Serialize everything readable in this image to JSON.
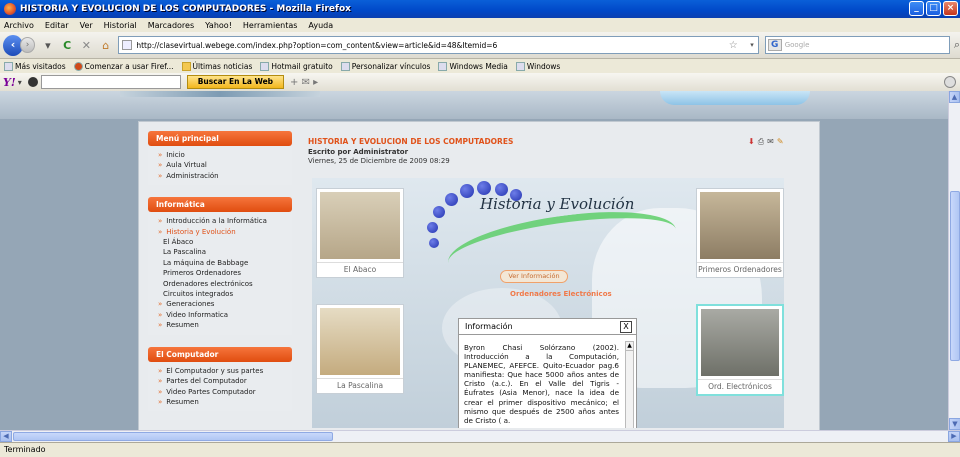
{
  "window": {
    "title": "HISTORIA Y EVOLUCION DE LOS COMPUTADORES - Mozilla Firefox"
  },
  "menubar": {
    "items": [
      "Archivo",
      "Editar",
      "Ver",
      "Historial",
      "Marcadores",
      "Yahoo!",
      "Herramientas",
      "Ayuda"
    ]
  },
  "navbar": {
    "url": "http://clasevirtual.webege.com/index.php?option=com_content&view=article&id=48&Itemid=6",
    "search_placeholder": "Google"
  },
  "bookmarks": {
    "items": [
      "Más visitados",
      "Comenzar a usar Firef...",
      "Últimas noticias",
      "Hotmail gratuito",
      "Personalizar vínculos",
      "Windows Media",
      "Windows"
    ]
  },
  "yahoo": {
    "logo": "Y!",
    "search_button": "Buscar En La Web"
  },
  "sidebar": {
    "menu_principal": {
      "title": "Menú principal",
      "items": [
        "Inicio",
        "Aula Virtual",
        "Administración"
      ]
    },
    "informatica": {
      "title": "Informática",
      "items": [
        "Introducción a la Informática",
        "Historia y Evolución"
      ],
      "subitems": [
        "El Ábaco",
        "La Pascalina",
        "La máquina de Babbage",
        "Primeros Ordenadores",
        "Ordenadores electrónicos",
        "Circuitos integrados"
      ],
      "more": [
        "Generaciones",
        "Video Informatica",
        "Resumen"
      ]
    },
    "computador": {
      "title": "El Computador",
      "items": [
        "El Computador y sus partes",
        "Partes del Computador",
        "Video Partes Computador",
        "Resumen"
      ]
    }
  },
  "article": {
    "title": "HISTORIA Y EVOLUCION DE LOS COMPUTADORES",
    "author": "Escrito por Administrator",
    "date": "Viernes, 25 de Diciembre de 2009 08:29"
  },
  "gallery": {
    "heading": "Historia y Evolución",
    "ver_info": "Ver Información",
    "current_label": "Ordenadores Electrónicos",
    "thumbs": [
      "El Abaco",
      "Primeros Ordenadores",
      "La Pascalina",
      "Ord. Electrónicos"
    ]
  },
  "infobox": {
    "title": "Información",
    "close": "X",
    "text": "Byron Chasi Solórzano (2002). Introducción a la Computación, PLANEMEC, AFEFCE. Quito-Ecuador pag.6 manifiesta: Que hace 5000 años antes de Cristo (a.c.). En el Valle del Tigris - Éufrates (Asia Menor), nace la idea de crear el primer dispositivo mecánico; el mismo que después de 2500 años antes de Cristo ( a."
  },
  "status": {
    "text": "Terminado"
  }
}
